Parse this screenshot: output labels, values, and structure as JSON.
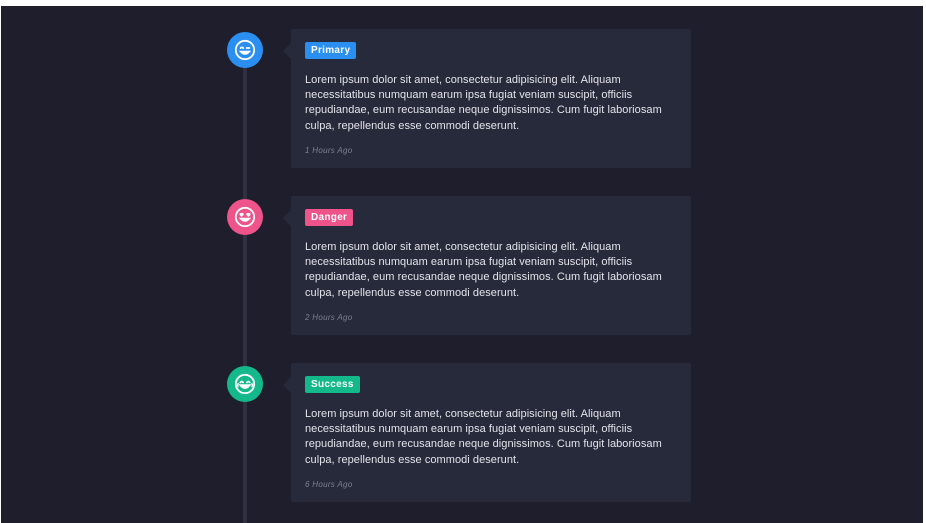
{
  "timeline": {
    "items": [
      {
        "badge": "Primary",
        "color": "#2a8ff0",
        "icon": "winking-face-icon",
        "text": "Lorem ipsum dolor sit amet, consectetur adipisicing elit. Aliquam necessitatibus numquam earum ipsa fugiat veniam suscipit, officiis repudiandae, eum recusandae neque dignissimos. Cum fugit laboriosam culpa, repellendus esse commodi deserunt.",
        "time": "1 Hours Ago"
      },
      {
        "badge": "Danger",
        "color": "#ee5389",
        "icon": "heart-eyes-face-icon",
        "text": "Lorem ipsum dolor sit amet, consectetur adipisicing elit. Aliquam necessitatibus numquam earum ipsa fugiat veniam suscipit, officiis repudiandae, eum recusandae neque dignissimos. Cum fugit laboriosam culpa, repellendus esse commodi deserunt.",
        "time": "2 Hours Ago"
      },
      {
        "badge": "Success",
        "color": "#13b98a",
        "icon": "laughing-face-icon",
        "text": "Lorem ipsum dolor sit amet, consectetur adipisicing elit. Aliquam necessitatibus numquam earum ipsa fugiat veniam suscipit, officiis repudiandae, eum recusandae neque dignissimos. Cum fugit laboriosam culpa, repellendus esse commodi deserunt.",
        "time": "6 Hours Ago"
      }
    ]
  }
}
